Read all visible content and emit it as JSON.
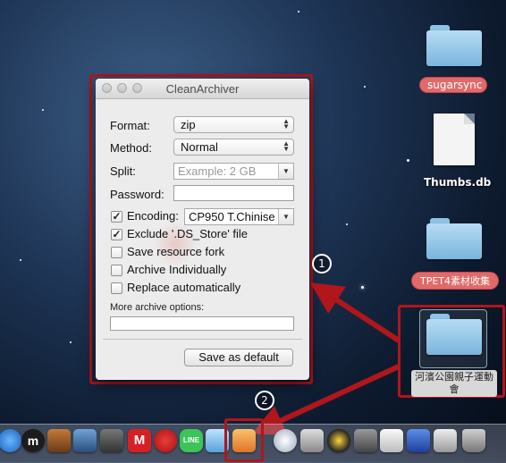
{
  "window": {
    "title": "CleanArchiver",
    "format_label": "Format:",
    "format_value": "zip",
    "method_label": "Method:",
    "method_value": "Normal",
    "split_label": "Split:",
    "split_placeholder": "Example: 2 GB",
    "password_label": "Password:",
    "encoding_label": "Encoding:",
    "encoding_value": "CP950 T.Chinise",
    "exclude_ds_store": "Exclude '.DS_Store' file",
    "save_resource_fork": "Save resource fork",
    "archive_individually": "Archive Individually",
    "replace_automatically": "Replace automatically",
    "more_options_label": "More archive options:",
    "save_default_button": "Save as default",
    "checkboxes": {
      "encoding": true,
      "exclude": true,
      "resource_fork": false,
      "individually": false,
      "replace": false
    }
  },
  "desktop": {
    "items": [
      {
        "name": "sugarsync"
      },
      {
        "name": "Thumbs.db"
      },
      {
        "name": "TPET4素材收集"
      },
      {
        "name": "河濱公園親子運動會"
      }
    ]
  },
  "annotations": {
    "callout_1": "1",
    "callout_2": "2"
  },
  "colors": {
    "highlight": "#b0161b",
    "label_red": "#e06a6a",
    "folder_blue": "#8ec3e6"
  }
}
